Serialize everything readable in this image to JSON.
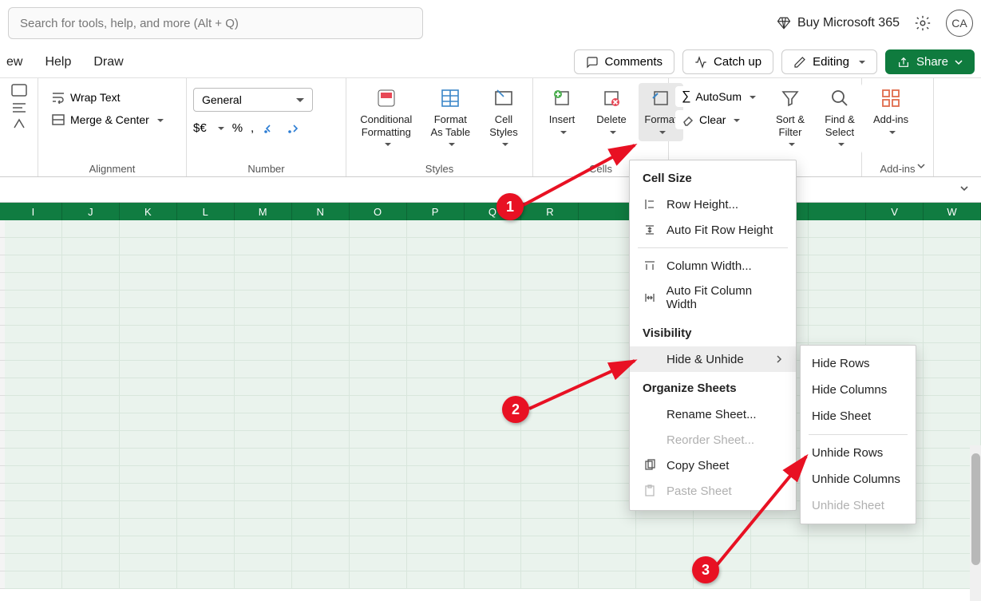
{
  "topbar": {
    "search_placeholder": "Search for tools, help, and more (Alt + Q)",
    "buy_label": "Buy Microsoft 365",
    "avatar_initials": "CA"
  },
  "menubar": {
    "tabs": [
      "ew",
      "Help",
      "Draw"
    ],
    "comments": "Comments",
    "catchup": "Catch up",
    "editing": "Editing",
    "share": "Share"
  },
  "ribbon": {
    "alignment": {
      "label": "Alignment",
      "wrap": "Wrap Text",
      "merge": "Merge & Center"
    },
    "number": {
      "label": "Number",
      "format": "General",
      "items": [
        "$€",
        "%",
        ","
      ]
    },
    "styles": {
      "label": "Styles",
      "cond": "Conditional Formatting",
      "table": "Format As Table",
      "cell": "Cell Styles"
    },
    "cells": {
      "label": "Cells",
      "insert": "Insert",
      "delete": "Delete",
      "format": "Format"
    },
    "editing": {
      "autosum": "AutoSum",
      "clear": "Clear",
      "sort": "Sort & Filter",
      "find": "Find & Select"
    },
    "addins": {
      "label": "Add-ins",
      "btn": "Add-ins"
    }
  },
  "columns": [
    "I",
    "J",
    "K",
    "L",
    "M",
    "N",
    "O",
    "P",
    "Q",
    "R",
    "",
    "",
    "",
    "",
    "",
    "V",
    "W"
  ],
  "format_menu": {
    "h1": "Cell Size",
    "row_height": "Row Height...",
    "autofit_row": "Auto Fit Row Height",
    "col_width": "Column Width...",
    "autofit_col": "Auto Fit Column Width",
    "h2": "Visibility",
    "hide_unhide": "Hide & Unhide",
    "h3": "Organize Sheets",
    "rename": "Rename Sheet...",
    "reorder": "Reorder Sheet...",
    "copy": "Copy Sheet",
    "paste": "Paste Sheet"
  },
  "hide_menu": {
    "hide_rows": "Hide Rows",
    "hide_cols": "Hide Columns",
    "hide_sheet": "Hide Sheet",
    "unhide_rows": "Unhide Rows",
    "unhide_cols": "Unhide Columns",
    "unhide_sheet": "Unhide Sheet"
  },
  "callouts": {
    "c1": "1",
    "c2": "2",
    "c3": "3"
  }
}
